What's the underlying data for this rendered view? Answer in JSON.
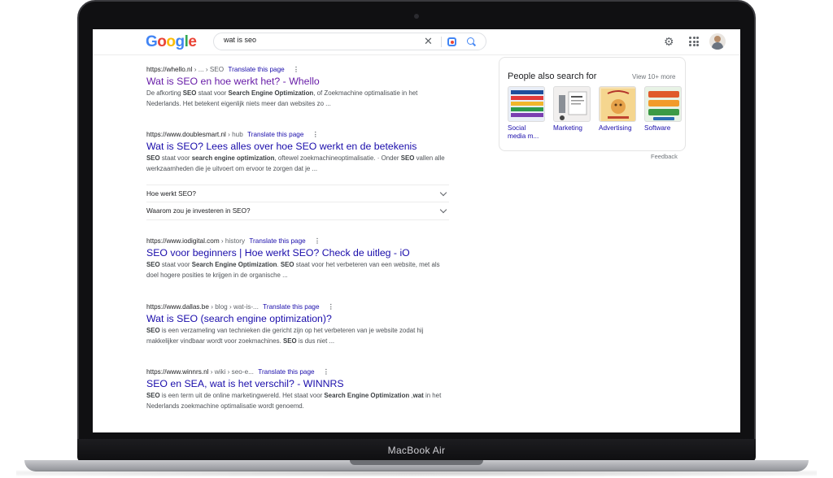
{
  "device": {
    "label": "MacBook Air"
  },
  "google": {
    "logo_letters": [
      "G",
      "o",
      "o",
      "g",
      "l",
      "e"
    ],
    "search": {
      "query": "wat is seo"
    },
    "icons": [
      "close-icon",
      "lens-icon",
      "search-icon",
      "gear-icon",
      "apps-icon",
      "avatar"
    ]
  },
  "results": [
    {
      "url_host": "https://whello.nl",
      "url_path": " › ... › SEO",
      "translate": "Translate this page",
      "title": "Wat is SEO en hoe werkt het? - Whello",
      "visited": true,
      "snippet_html": "De afkorting <b>SEO</b> staat voor <b>Search Engine Optimization</b>, of Zoekmachine optimalisatie in het Nederlands. Het betekent eigenlijk niets meer dan websites zo ..."
    },
    {
      "url_host": "https://www.doublesmart.nl",
      "url_path": " › hub",
      "translate": "Translate this page",
      "title": "Wat is SEO? Lees alles over hoe SEO werkt en de betekenis",
      "visited": false,
      "snippet_html": "<b>SEO</b> staat voor <b>search engine optimization</b>, oftewel zoekmachineoptimalisatie. · Onder <b>SEO</b> vallen alle werkzaamheden die je uitvoert om ervoor te zorgen dat je ..."
    },
    {
      "url_host": "https://www.iodigital.com",
      "url_path": " › history",
      "translate": "Translate this page",
      "title": "SEO voor beginners | Hoe werkt SEO? Check de uitleg - iO",
      "visited": false,
      "snippet_html": "<b>SEO</b> staat voor <b>Search Engine Optimization</b>. <b>SEO</b> staat voor het verbeteren van een website, met als doel hogere posities te krijgen in de organische ..."
    },
    {
      "url_host": "https://www.dallas.be",
      "url_path": " › blog › wat-is-...",
      "translate": "Translate this page",
      "title": "Wat is SEO (search engine optimization)?",
      "visited": false,
      "snippet_html": "<b>SEO</b> is een verzameling van technieken die gericht zijn op het verbeteren van je website zodat hij makkelijker vindbaar wordt voor zoekmachines. <b>SEO</b> is dus niet ..."
    },
    {
      "url_host": "https://www.winnrs.nl",
      "url_path": " › wiki › seo-e...",
      "translate": "Translate this page",
      "title": "SEO en SEA, wat is het verschil? - WINNRS",
      "visited": false,
      "snippet_html": "<b>SEO</b> is een term uit de online marketingwereld. Het staat voor <b>Search Engine Optimization</b> ,<b>wat</b> in het Nederlands zoekmachine optimalisatie wordt genoemd."
    }
  ],
  "faq": [
    "Hoe werkt SEO?",
    "Waarom zou je investeren in SEO?"
  ],
  "side_panel": {
    "title": "People also search for",
    "more": "View 10+ more",
    "items": [
      {
        "label": "Social media m...",
        "icon": "social-media-thumbnail"
      },
      {
        "label": "Marketing",
        "icon": "marketing-thumbnail"
      },
      {
        "label": "Advertising",
        "icon": "advertising-thumbnail"
      },
      {
        "label": "Software",
        "icon": "software-thumbnail"
      }
    ],
    "feedback": "Feedback"
  },
  "colors": {
    "link": "#1a0dab",
    "visited": "#681da8",
    "brand_blue": "#4285f4",
    "brand_red": "#ea4335",
    "brand_yellow": "#fbbc05",
    "brand_green": "#34a853"
  }
}
